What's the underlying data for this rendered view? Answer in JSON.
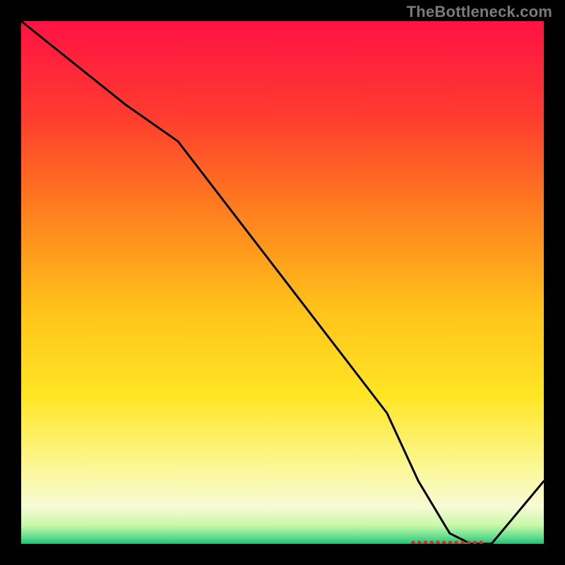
{
  "watermark": "TheBottleneck.com",
  "chart_data": {
    "type": "line",
    "title": "",
    "xlabel": "",
    "ylabel": "",
    "xlim": [
      0,
      100
    ],
    "ylim": [
      0,
      100
    ],
    "x": [
      0,
      10,
      20,
      30,
      40,
      50,
      60,
      70,
      76,
      82,
      86,
      90,
      100
    ],
    "values": [
      100,
      92,
      84,
      77,
      64,
      51,
      38,
      25,
      12,
      2,
      0,
      0,
      12
    ],
    "gradient_stops": [
      {
        "t": 0.0,
        "c": "#ff1244"
      },
      {
        "t": 0.18,
        "c": "#ff3b2f"
      },
      {
        "t": 0.35,
        "c": "#ff7a1f"
      },
      {
        "t": 0.55,
        "c": "#ffc21a"
      },
      {
        "t": 0.72,
        "c": "#ffe625"
      },
      {
        "t": 0.86,
        "c": "#fbf89a"
      },
      {
        "t": 0.93,
        "c": "#f6fbd6"
      },
      {
        "t": 0.965,
        "c": "#c8f7a8"
      },
      {
        "t": 0.985,
        "c": "#6ee08f"
      },
      {
        "t": 1.0,
        "c": "#1ec47a"
      }
    ],
    "markers": {
      "x_start": 75,
      "x_end": 88,
      "count": 12,
      "y": 0.2,
      "color": "#c43a2a",
      "r": 3.0
    }
  }
}
